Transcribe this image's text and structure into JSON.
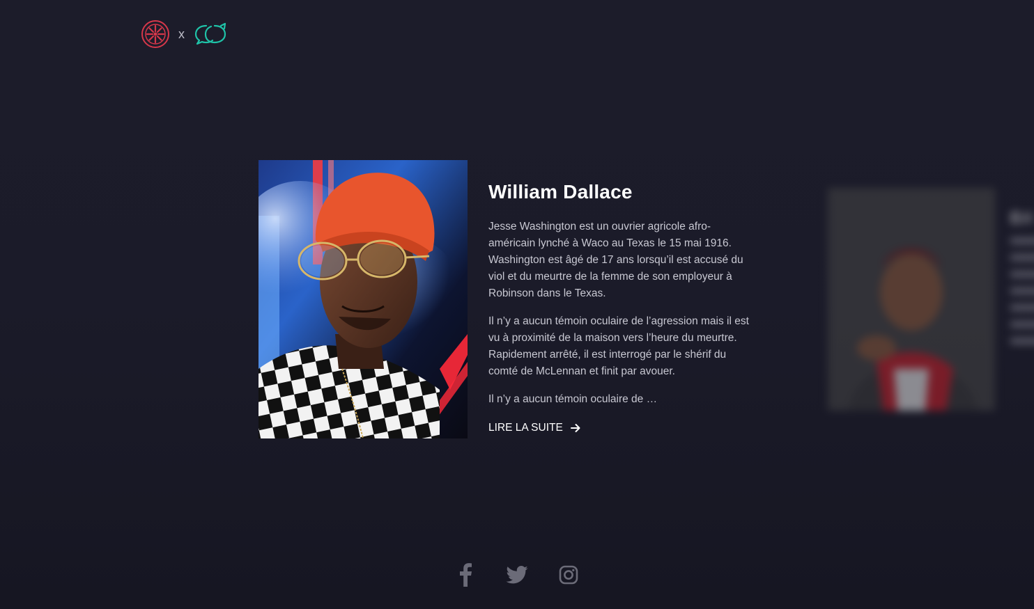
{
  "header": {
    "separator": "x",
    "brand_color_a": "#d6374a",
    "brand_color_b": "#1fc3a8"
  },
  "card": {
    "name": "William Dallace",
    "paragraphs": [
      "Jesse Washington est un ouvrier agricole afro-américain lynché à Waco au Texas le 15 mai 1916. Washington est âgé de 17 ans lorsqu’il est accusé du viol et du meurtre de la femme de son employeur à Robinson dans le Texas.",
      "Il n’y a aucun témoin oculaire de l’agression mais il est vu à proximité de la maison vers l’heure du meurtre. Rapidement arrêté, il est interrogé par le shérif du comté de McLennan et finit par avouer.",
      "Il n’y a aucun témoin oculaire de …"
    ],
    "read_more": "LIRE LA SUITE",
    "read_more_icon": "arrow-right-icon"
  },
  "next_card": {
    "name_partial": "Eri"
  },
  "social": {
    "icons": [
      "facebook-icon",
      "twitter-icon",
      "instagram-icon"
    ],
    "color": "#6b6b78"
  },
  "colors": {
    "background": "#1c1c2b",
    "text_primary": "#ffffff",
    "text_secondary": "#c8c8d2"
  }
}
